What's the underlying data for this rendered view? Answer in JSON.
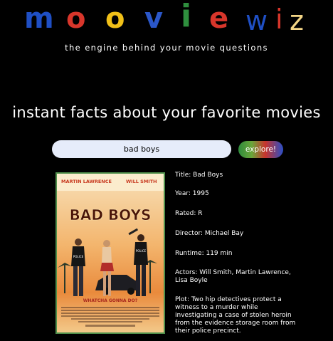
{
  "logo": {
    "letters": [
      {
        "char": "m",
        "color": "#1f4fc4"
      },
      {
        "char": "o",
        "color": "#d8362b"
      },
      {
        "char": "o",
        "color": "#f1c018"
      },
      {
        "char": "v",
        "color": "#2b57c9"
      },
      {
        "char": "i",
        "color": "#2f8f3e"
      },
      {
        "char": "e",
        "color": "#d8362b"
      },
      {
        "char": "w",
        "color": "#1f4fc4"
      },
      {
        "char": "i",
        "color": "#d8362b"
      },
      {
        "char": "z",
        "color": "#f3d586"
      }
    ]
  },
  "tagline": "the engine behind your movie questions",
  "headline": "instant facts about your favorite movies",
  "search": {
    "value": "bad boys"
  },
  "explore_label": "explore!",
  "poster": {
    "actor_left": "MARTIN LAWRENCE",
    "actor_right": "WILL SMITH",
    "title": "BAD BOYS",
    "tagline": "WHATCHA GONNA DO?"
  },
  "movie": {
    "title": "Title: Bad Boys",
    "year": "Year: 1995",
    "rated": "Rated: R",
    "director": "Director: Michael Bay",
    "runtime": "Runtime: 119 min",
    "actors": "Actors: Will Smith, Martin Lawrence, Lisa Boyle",
    "plot": "Plot: Two hip detectives protect a witness to a murder while investigating a case of stolen heroin from the evidence storage room from their police precinct."
  },
  "colors": {
    "accent_green": "#4f8f4b",
    "search_bg": "#e6ecfa"
  }
}
